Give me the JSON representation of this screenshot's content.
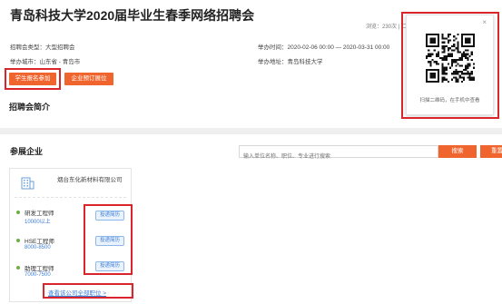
{
  "header": {
    "title": "青岛科技大学2020届毕业生春季网络招聘会",
    "views": "浏览：230次",
    "qr_link": "二维码"
  },
  "fair_info": {
    "type_label": "招聘会类型：大型招聘会",
    "time_label": "举办时间：2020-02-06 00:00 — 2020-03-31 00:00",
    "city_label": "举办城市：山东省 - 青岛市",
    "address_label": "举办地址：青岛科技大学"
  },
  "buttons": {
    "student_signup": "学生报名参加",
    "company_booking": "企业预订展位"
  },
  "sections": {
    "intro_title": "招聘会简介",
    "companies_title": "参展企业"
  },
  "qr_popup": {
    "close": "×",
    "caption": "扫描二维码，在手机中查看"
  },
  "search": {
    "placeholder": "输入单位名称、职位、专业进行搜索",
    "search_label": "搜索",
    "reset_label": "重置"
  },
  "company": {
    "name": "烟台东化新材料有限公司",
    "jobs": [
      {
        "title": "研发工程师",
        "salary": "10000以上",
        "apply": "投递简历"
      },
      {
        "title": "HSE工程师",
        "salary": "8000-8500",
        "apply": "投递简历"
      },
      {
        "title": "助理工程师",
        "salary": "7000-7500",
        "apply": "投递简历"
      }
    ],
    "view_all": "查看该公司全部职位 >"
  },
  "colors": {
    "accent": "#f0642d",
    "highlight_box": "#d9262d",
    "link": "#3e7dd6",
    "job_dot": "#6fae43"
  }
}
